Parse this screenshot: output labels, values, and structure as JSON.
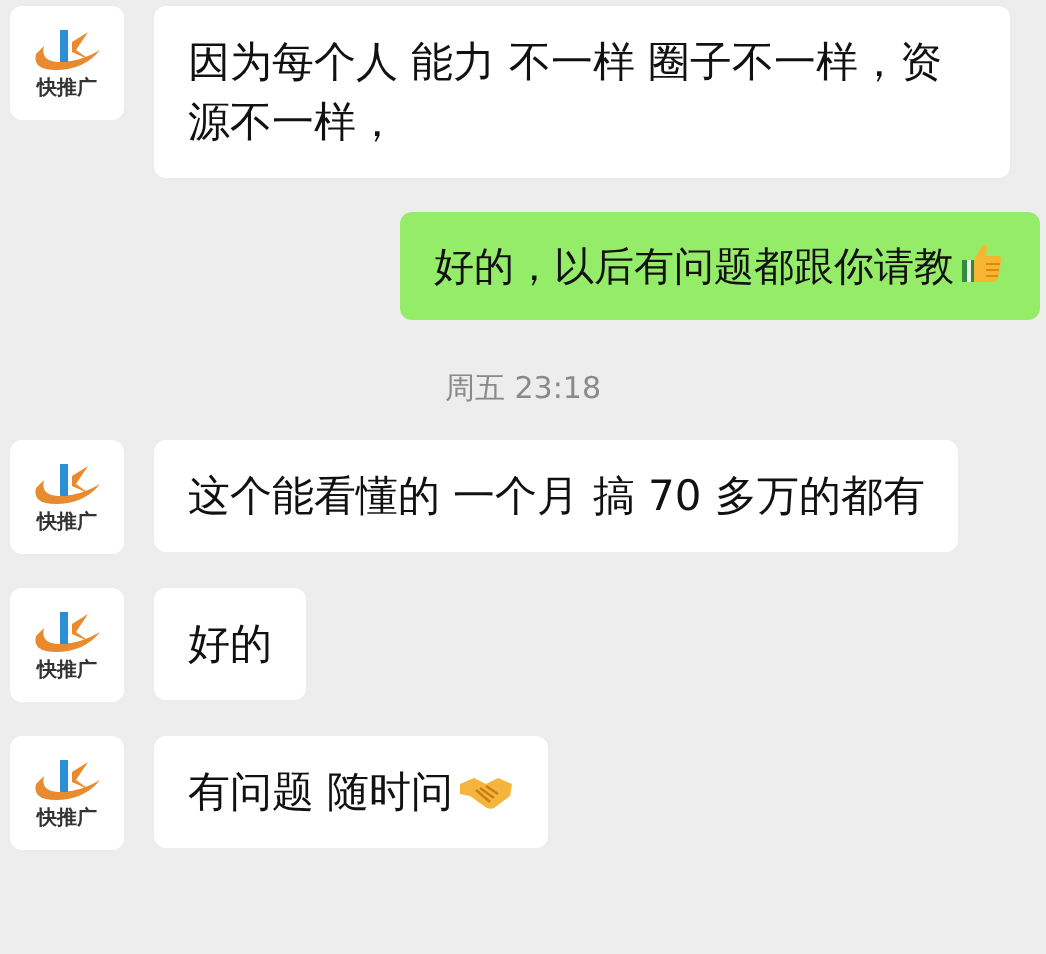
{
  "messages": [
    {
      "kind": "incoming",
      "avatar_label": "快推广",
      "text": "因为每个人 能力 不一样 圈子不一样，资源不一样，"
    },
    {
      "kind": "outgoing",
      "text": "好的，以后有问题都跟你请教",
      "emoji": {
        "kind": "thumbs-up"
      }
    },
    {
      "kind": "time",
      "text": "周五 23:18"
    },
    {
      "kind": "incoming",
      "avatar_label": "快推广",
      "text": "这个能看懂的 一个月 搞 70 多万的都有"
    },
    {
      "kind": "incoming",
      "avatar_label": "快推广",
      "text": "好的"
    },
    {
      "kind": "incoming",
      "avatar_label": "快推广",
      "text": "有问题 随时问",
      "emoji": {
        "kind": "handshake"
      }
    }
  ]
}
